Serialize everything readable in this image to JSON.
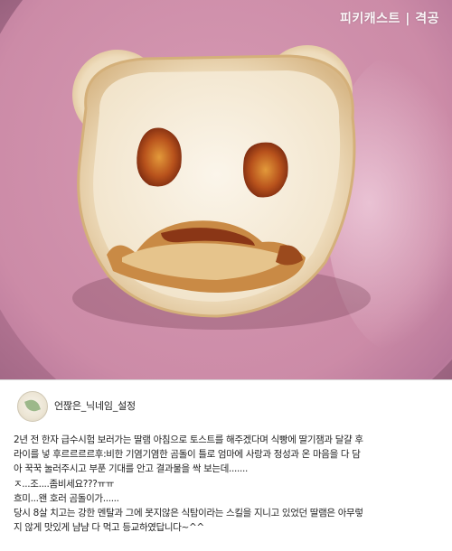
{
  "watermark": "피키캐스트 | 격공",
  "post": {
    "username": "언짢은_닉네임_설정",
    "lines": [
      "2년 전 한자 급수시험 보러가는 딸램 아침으로 토스트를 해주겠다며 식빵에 딸기잼과 달걀 후",
      "라이를 넣 후르르르르후:비한 기염기염한 곰돌이 틀로 엄마에 사랑과 정성과 온 마음을 다 담",
      "아 꾹꾹 눌러주시고 부푼 기대를 안고 결과물을 싹 보는데.......",
      "ㅈ...조....좀비세요???ㅠㅠ",
      "흐미...왠 호러 곰돌이가......",
      "당시 8살 치고는 강한 멘탈과 그에 못지않은 식탐이라는 스킬을 지니고 있었던 딸램은 아무렇",
      "지 않게 맛있게 냠냠 다 먹고 등교하였답니다~^^"
    ]
  }
}
